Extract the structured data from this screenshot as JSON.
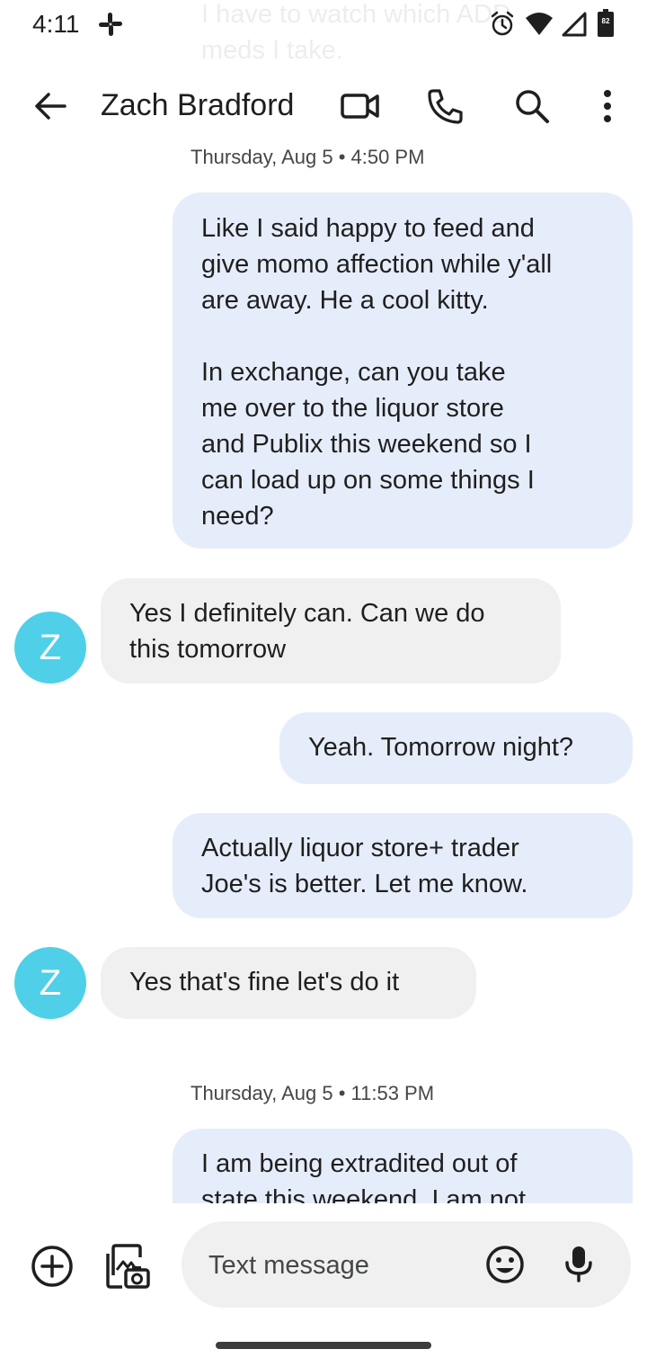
{
  "status_bar": {
    "time": "4:11",
    "icons": [
      "slack-icon",
      "alarm-icon",
      "wifi-icon",
      "signal-icon",
      "battery-icon"
    ],
    "battery_level": "82"
  },
  "header": {
    "title": "Zach Bradford",
    "icons": [
      "back-arrow-icon",
      "video-call-icon",
      "phone-icon",
      "search-icon",
      "more-vert-icon"
    ]
  },
  "conversation": {
    "ghost_prev_text": "I have  to watch which ADD\nmeds I take.",
    "ghost_timestamp": "Thursday, Aug 5 • 4:50 PM",
    "msg1": "Like I said happy to feed and\ngive momo affection while y'all\nare away. He a cool kitty.\n\nIn exchange, can you take\nme over to the liquor store\nand Publix this weekend so I\ncan load up on some things I\nneed?",
    "avatar_initial": "Z",
    "msg2": "Yes I definitely can. Can we do\nthis tomorrow",
    "msg3": "Yeah. Tomorrow night?",
    "msg4": "Actually liquor store+ trader\nJoe's is better. Let me know.",
    "msg5": "Yes that's fine let's do it",
    "timestamp2": "Thursday, Aug 5 • 11:53 PM",
    "msg6": "I am being extradited out of\nstate this weekend. I am not"
  },
  "compose": {
    "placeholder": "Text message",
    "icons": [
      "add-circle-icon",
      "gallery-camera-icon",
      "emoji-icon",
      "microphone-icon"
    ]
  },
  "colors": {
    "outgoing_bubble": "#e6edfa",
    "incoming_bubble": "#f0f0f0",
    "avatar": "#4fd0e8"
  }
}
